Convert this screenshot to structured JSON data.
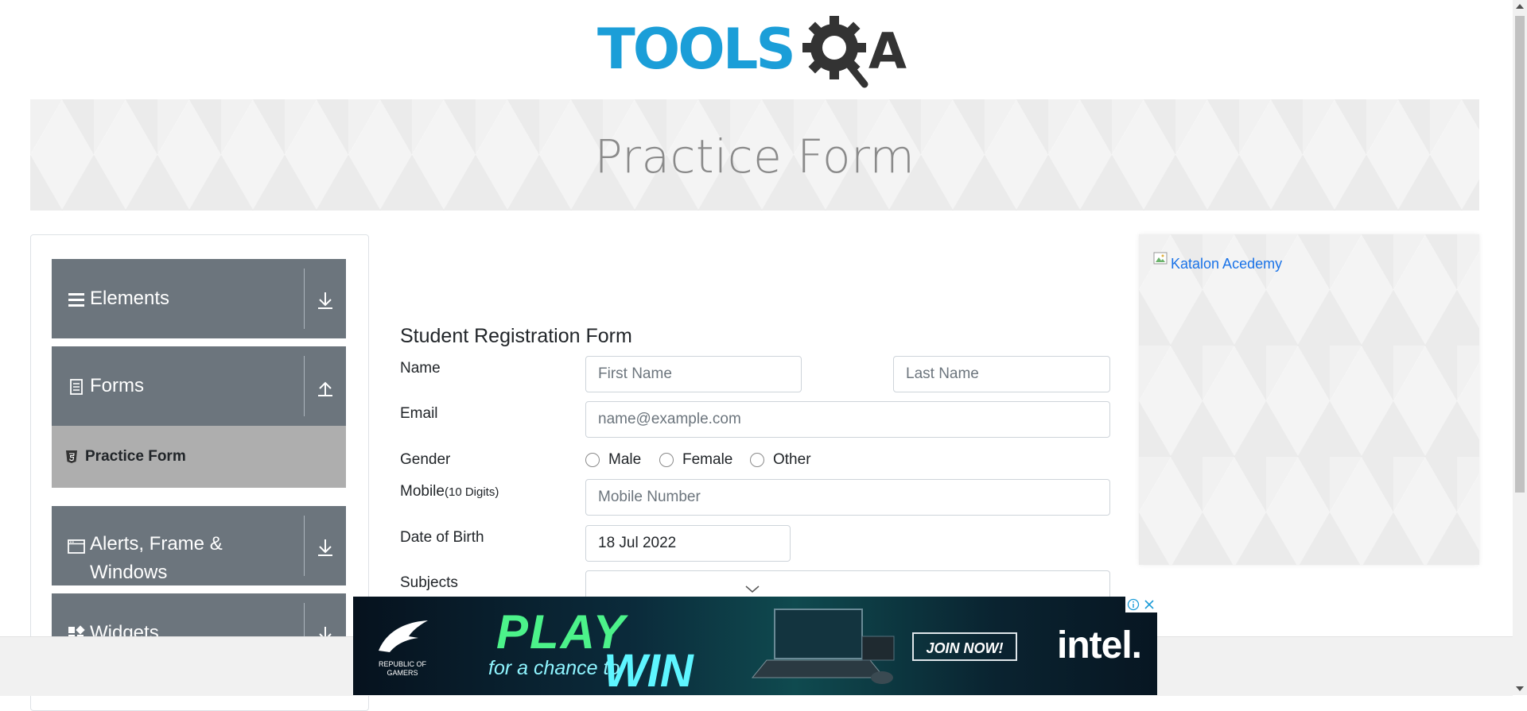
{
  "header": {
    "logo_text_left": "TOOLS",
    "logo_text_right": "A"
  },
  "banner": {
    "title": "Practice Form"
  },
  "sidebar": {
    "groups": [
      {
        "label": "Elements",
        "icon": "hamburger-icon",
        "arrow": "expand-down-icon"
      },
      {
        "label": "Forms",
        "icon": "document-icon",
        "arrow": "collapse-up-icon",
        "items": [
          {
            "label": "Practice Form",
            "icon": "html5-icon",
            "active": true
          }
        ]
      },
      {
        "label": "Alerts, Frame &",
        "label_line2": "Windows",
        "icon": "window-icon",
        "arrow": "expand-down-icon"
      },
      {
        "label": "Widgets",
        "icon": "widgets-icon",
        "arrow": "expand-down-icon"
      }
    ]
  },
  "form": {
    "title": "Student Registration Form",
    "name_label": "Name",
    "first_name_placeholder": "First Name",
    "last_name_placeholder": "Last Name",
    "email_label": "Email",
    "email_placeholder": "name@example.com",
    "gender_label": "Gender",
    "gender_options": [
      "Male",
      "Female",
      "Other"
    ],
    "mobile_label": "Mobile",
    "mobile_hint": "(10 Digits)",
    "mobile_placeholder": "Mobile Number",
    "dob_label": "Date of Birth",
    "dob_value": "18 Jul 2022",
    "subjects_label": "Subjects"
  },
  "side_ad": {
    "alt_text": "Katalon Acedemy"
  },
  "bottom_ad": {
    "brand_left": "REPUBLIC OF GAMERS",
    "headline": "PLAY",
    "subline": "for a chance to",
    "headline2": "WIN",
    "cta": "JOIN NOW!",
    "brand_right": "intel."
  },
  "colors": {
    "sidebar_header": "#6c757d",
    "sidebar_active": "#aeaeae",
    "logo_blue": "#1b9ed8",
    "logo_dark": "#333333",
    "banner_text": "#8a8a8a"
  }
}
